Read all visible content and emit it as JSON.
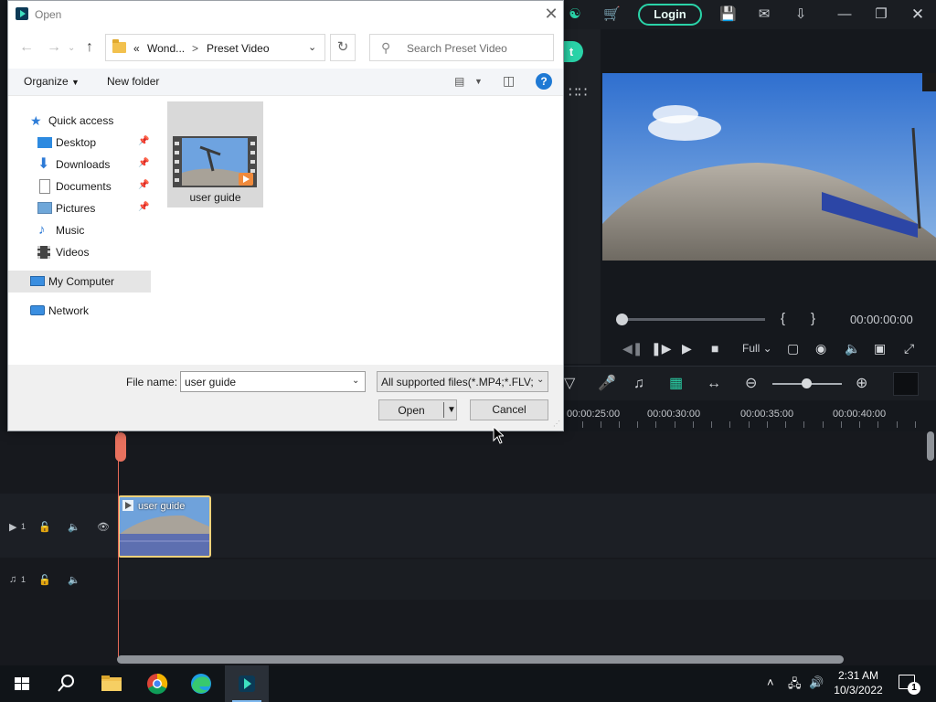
{
  "editor": {
    "login_label": "Login",
    "export_letter": "t",
    "timecode": "00:00:00:00",
    "brace_open": "{",
    "brace_close": "}",
    "zoom_mode": "Full",
    "ruler_ticks": [
      "00:00:25:00",
      "00:00:30:00",
      "00:00:35:00",
      "00:00:40:00"
    ],
    "tracks": {
      "video": {
        "number": "1"
      },
      "audio": {
        "number": "1"
      }
    },
    "clip_label": "user guide",
    "accent_color": "#2ad3a8",
    "playhead_color": "#e86a58"
  },
  "dialog": {
    "title": "Open",
    "breadcrumb": [
      "«",
      "Wond...",
      ">",
      "Preset Video"
    ],
    "search_placeholder": "Search Preset Video",
    "commands": {
      "organize": "Organize",
      "new_folder": "New folder"
    },
    "nav_items": [
      {
        "label": "Quick access",
        "icon": "star-icon",
        "pinned": false
      },
      {
        "label": "Desktop",
        "icon": "desktop-icon",
        "pinned": true
      },
      {
        "label": "Downloads",
        "icon": "download-icon",
        "pinned": true
      },
      {
        "label": "Documents",
        "icon": "document-icon",
        "pinned": true
      },
      {
        "label": "Pictures",
        "icon": "pictures-icon",
        "pinned": true
      },
      {
        "label": "Music",
        "icon": "music-icon",
        "pinned": false
      },
      {
        "label": "Videos",
        "icon": "videos-icon",
        "pinned": false
      },
      {
        "label": "My Computer",
        "icon": "computer-icon",
        "selected": true
      },
      {
        "label": "Network",
        "icon": "network-icon"
      }
    ],
    "files": [
      {
        "name": "user guide",
        "type": "video"
      }
    ],
    "file_name_label": "File name:",
    "file_name_value": "user guide",
    "filter": "All supported files(*.MP4;*.FLV;",
    "open_label": "Open",
    "cancel_label": "Cancel"
  },
  "taskbar": {
    "time": "2:31 AM",
    "date": "10/3/2022",
    "notification_count": "1",
    "apps": [
      "windows-start",
      "search",
      "file-explorer",
      "chrome",
      "edge",
      "filmora"
    ]
  }
}
